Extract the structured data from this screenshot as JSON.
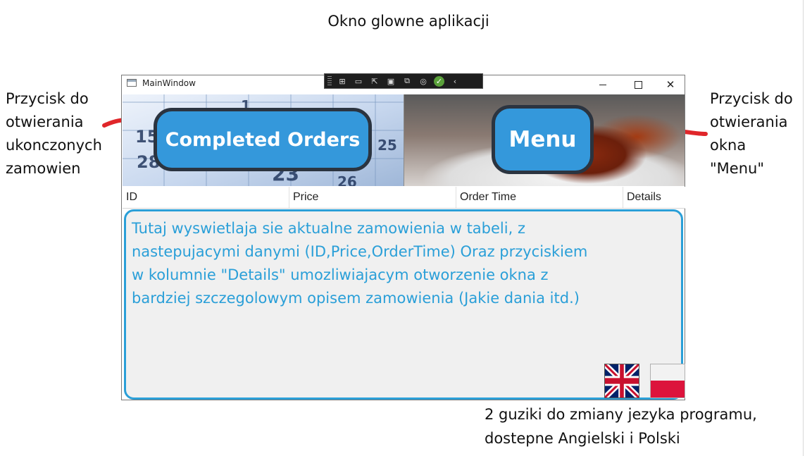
{
  "page": {
    "title": "Okno glowne aplikacji"
  },
  "annotations": {
    "left": [
      "Przycisk do",
      "otwierania",
      "ukonczonych",
      "zamowien"
    ],
    "right": [
      "Przycisk do",
      "otwierania",
      "okna",
      "\"Menu\""
    ],
    "bottom": [
      "2 guziki do zmiany jezyka programu,",
      "dostepne Angielski i Polski"
    ]
  },
  "window": {
    "title": "MainWindow",
    "close_glyph": "✕"
  },
  "header": {
    "completed_orders_label": "Completed Orders",
    "menu_label": "Menu"
  },
  "grid": {
    "columns": [
      "ID",
      "Price",
      "Order Time",
      "Details"
    ]
  },
  "orders_area": {
    "note_lines": [
      "Tutaj wyswietlaja sie aktualne zamowienia w tabeli, z",
      "nastepujacymi danymi (ID,Price,OrderTime) Oraz przyciskiem",
      "w kolumnie \"Details\" umozliwiajacym otworzenie okna z",
      "bardziej szczegolowym opisem zamowienia (Jakie dania itd.)"
    ]
  },
  "calendar_numbers": [
    "1",
    "15",
    "28",
    "23",
    "25",
    "26"
  ],
  "colors": {
    "accent": "#3498db",
    "annotation_arrow": "#e0262a",
    "orders_text": "#2a9fd8"
  },
  "icons": {
    "language_en": "uk-flag-icon",
    "language_pl": "poland-flag-icon"
  }
}
